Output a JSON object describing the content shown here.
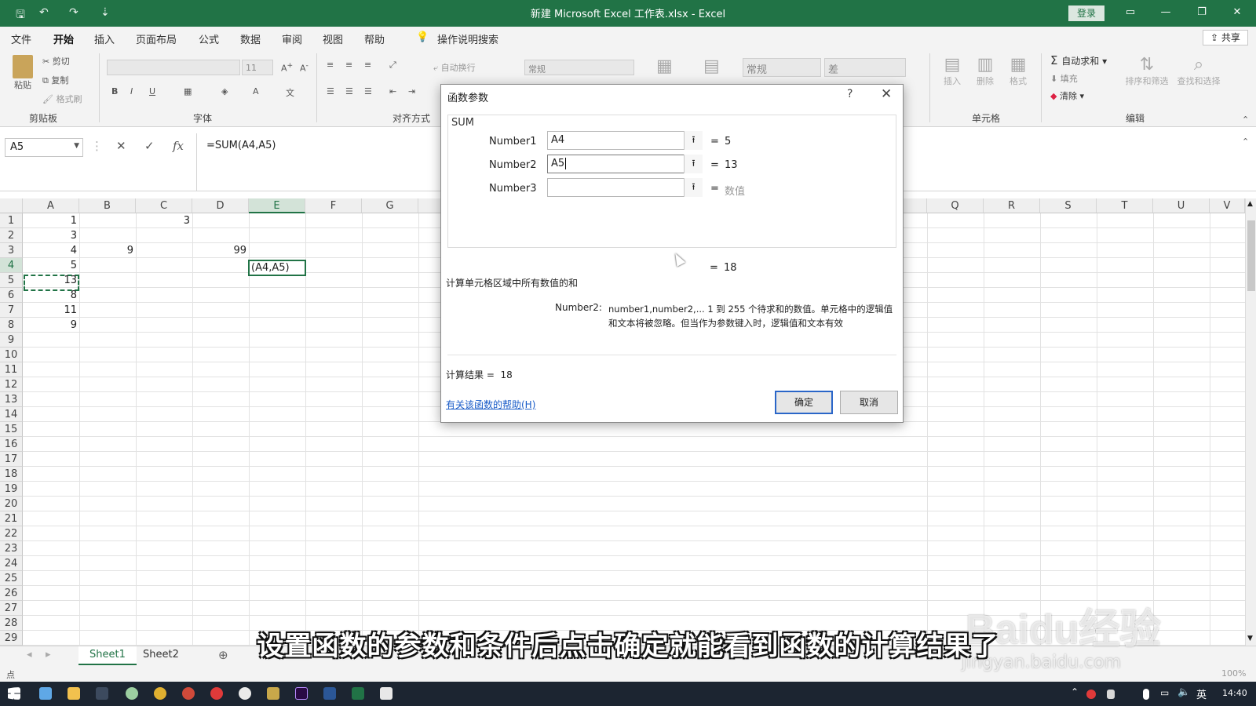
{
  "window": {
    "title": "新建 Microsoft Excel 工作表.xlsx  -  Excel",
    "login_label": "登录",
    "minimize_glyph": "—",
    "restore_glyph": "❐",
    "close_glyph": "✕"
  },
  "quick_access": {
    "save": "🖫",
    "undo": "↶",
    "redo": "↷",
    "customize": "⇣"
  },
  "tabs": [
    "文件",
    "开始",
    "插入",
    "页面布局",
    "公式",
    "数据",
    "审阅",
    "视图",
    "帮助",
    "操作说明搜索"
  ],
  "active_tab": "开始",
  "share_label": "共享",
  "ribbon": {
    "clipboard": {
      "paste": "粘贴",
      "cut": "剪切",
      "copy": "复制",
      "format_painter": "格式刷",
      "group": "剪贴板"
    },
    "font": {
      "size": "11",
      "group": "字体",
      "bold": "B",
      "italic": "I",
      "underline": "U"
    },
    "alignment": {
      "wrap": "自动换行",
      "group": "对齐方式"
    },
    "number": {
      "format": "常规"
    },
    "styles": {
      "normal": "常规",
      "bad": "差"
    },
    "cells": {
      "insert": "插入",
      "delete": "删除",
      "format": "格式",
      "group": "单元格"
    },
    "editing": {
      "autosum": "自动求和",
      "fill": "填充",
      "clear": "清除",
      "sort": "排序和筛选",
      "find": "查找和选择",
      "group": "编辑"
    }
  },
  "formula_bar": {
    "name_box": "A5",
    "cancel": "✕",
    "enter": "✓",
    "fx": "fx",
    "formula": "=SUM(A4,A5)"
  },
  "grid": {
    "columns": [
      "A",
      "B",
      "C",
      "D",
      "E",
      "F",
      "G",
      "Q",
      "R",
      "S",
      "T",
      "U",
      "V"
    ],
    "selected_column": "E",
    "rows": [
      "1",
      "2",
      "3",
      "4",
      "5",
      "6",
      "7",
      "8",
      "9",
      "10",
      "11",
      "12",
      "13",
      "14",
      "15",
      "16",
      "17",
      "18",
      "19",
      "20",
      "21",
      "22",
      "23",
      "24",
      "25",
      "26",
      "27",
      "28",
      "29"
    ],
    "selected_row": "4",
    "cells": {
      "A1": "1",
      "C1": "3",
      "A2": "3",
      "A3": "4",
      "B3": "9",
      "D3": "99",
      "A4": "5",
      "A5": "13",
      "A6": "8",
      "A7": "11",
      "A8": "9"
    },
    "editing_cell_text": "(A4,A5)"
  },
  "sheets": [
    "Sheet1",
    "Sheet2"
  ],
  "active_sheet": "Sheet1",
  "add_sheet": "⊕",
  "status": {
    "mode": "点",
    "zoom": "100%"
  },
  "dialog": {
    "title": "函数参数",
    "help_glyph": "?",
    "close_glyph": "✕",
    "function_name": "SUM",
    "args": [
      {
        "label": "Number1",
        "value": "A4",
        "result": "5"
      },
      {
        "label": "Number2",
        "value": "A5",
        "result": "13"
      },
      {
        "label": "Number3",
        "value": "",
        "result": "数值"
      }
    ],
    "eq": "=",
    "total": "18",
    "description": "计算单元格区域中所有数值的和",
    "param_name": "Number2:",
    "param_desc": "number1,number2,... 1 到 255 个待求和的数值。单元格中的逻辑值和文本将被忽略。但当作为参数键入时，逻辑值和文本有效",
    "result_label": "计算结果 =",
    "result_value": "18",
    "help_link": "有关该函数的帮助(H)",
    "ok": "确定",
    "cancel": "取消"
  },
  "taskbar": {
    "time": "14:40"
  },
  "overlay": {
    "caption": "设置函数的参数和条件后点击确定就能看到函数的计算结果了",
    "watermark": "Baidu经验",
    "watermark_sub": "jingyan.baidu.com"
  },
  "colors": {
    "excel_green": "#217346",
    "taskbar": "#1c2531",
    "link": "#1a5cc8"
  }
}
